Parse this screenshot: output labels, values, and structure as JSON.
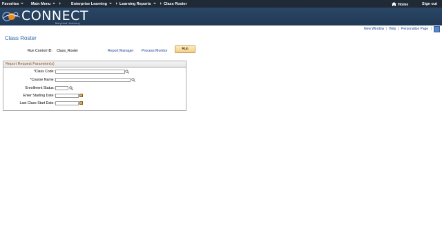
{
  "nav": {
    "favorites": "Favorites",
    "main_menu": "Main Menu",
    "enterprise_learning": "Enterprise Learning",
    "learning_reports": "Learning Reports",
    "current": "Class Roster",
    "home": "Home",
    "sign_out": "Sign out"
  },
  "brand": {
    "name": "CONNECT",
    "tagline": "Maryland Judiciary"
  },
  "pagebar": {
    "new_window": "New Window",
    "help": "Help",
    "personalize": "Personalize Page"
  },
  "page": {
    "title": "Class Roster",
    "run_control_label": "Run Control ID:",
    "run_control_value": "Class_Roster",
    "report_manager": "Report Manager",
    "process_monitor": "Process Monitor",
    "run_button": "Run"
  },
  "params": {
    "header": "Report Request Parameter(s)",
    "class_code_label": "*Class Code:",
    "course_name_label": "*Course Name:",
    "enrollment_status_label": "Enrollment Status:",
    "enter_starting_date_label": "Enter Starting Date:",
    "last_class_start_date_label": "Last Class Start Date:",
    "class_code_value": "",
    "course_name_value": "",
    "enrollment_status_value": "",
    "enter_starting_date_value": "",
    "last_class_start_date_value": ""
  },
  "colors": {
    "topnav_bg": "#1f2a36",
    "banner_bg": "#2b4766",
    "title": "#2e6aa8",
    "link": "#1c3f8f",
    "group_header_text": "#8a4b12",
    "run_button": "#f5cf86"
  },
  "icons": [
    "home-icon",
    "lookup-icon",
    "calendar-icon",
    "help-icon",
    "connect-logo-icon"
  ]
}
